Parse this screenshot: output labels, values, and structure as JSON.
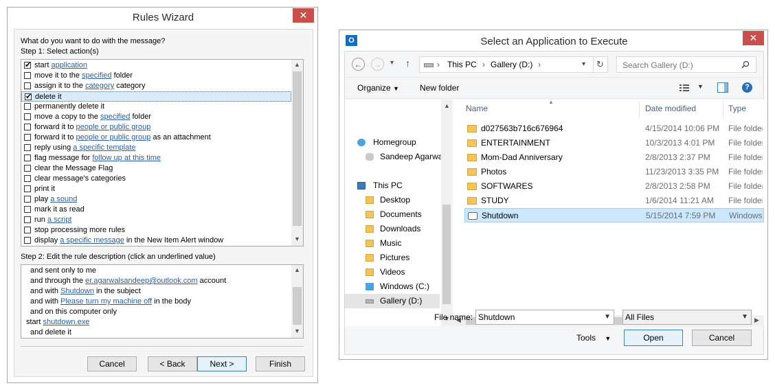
{
  "rules_wizard": {
    "title": "Rules Wizard",
    "close": "✕",
    "question": "What do you want to do with the message?",
    "step1": "Step 1: Select action(s)",
    "actions": [
      {
        "checked": true,
        "pre": "start ",
        "link": "application",
        "post": ""
      },
      {
        "checked": false,
        "pre": "move it to the ",
        "link": "specified",
        "post": " folder"
      },
      {
        "checked": false,
        "pre": "assign it to the ",
        "link": "category",
        "post": " category"
      },
      {
        "checked": true,
        "pre": "delete it",
        "link": "",
        "post": ""
      },
      {
        "checked": false,
        "pre": "permanently delete it",
        "link": "",
        "post": ""
      },
      {
        "checked": false,
        "pre": "move a copy to the ",
        "link": "specified",
        "post": " folder"
      },
      {
        "checked": false,
        "pre": "forward it to ",
        "link": "people or public group",
        "post": ""
      },
      {
        "checked": false,
        "pre": "forward it to ",
        "link": "people or public group",
        "post": " as an attachment"
      },
      {
        "checked": false,
        "pre": "reply using ",
        "link": "a specific template",
        "post": ""
      },
      {
        "checked": false,
        "pre": "flag message for ",
        "link": "follow up at this time",
        "post": ""
      },
      {
        "checked": false,
        "pre": "clear the Message Flag",
        "link": "",
        "post": ""
      },
      {
        "checked": false,
        "pre": "clear message's categories",
        "link": "",
        "post": ""
      },
      {
        "checked": false,
        "pre": "print it",
        "link": "",
        "post": ""
      },
      {
        "checked": false,
        "pre": "play ",
        "link": "a sound",
        "post": ""
      },
      {
        "checked": false,
        "pre": "mark it as read",
        "link": "",
        "post": ""
      },
      {
        "checked": false,
        "pre": "run ",
        "link": "a script",
        "post": ""
      },
      {
        "checked": false,
        "pre": "stop processing more rules",
        "link": "",
        "post": ""
      },
      {
        "checked": false,
        "pre": "display ",
        "link": "a specific message",
        "post": " in the New Item Alert window"
      }
    ],
    "check_mark": "✔",
    "step2": "Step 2: Edit the rule description (click an underlined value)",
    "description": [
      {
        "indent": 1,
        "pre": "and sent only to me",
        "link": "",
        "post": ""
      },
      {
        "indent": 1,
        "pre": "and through the ",
        "link": "er.agarwalsandeep@outlook.com",
        "post": " account"
      },
      {
        "indent": 1,
        "pre": "and with ",
        "link": "Shutdown",
        "post": " in the subject"
      },
      {
        "indent": 1,
        "pre": "and with ",
        "link": "Please turn my machine off",
        "post": " in the body"
      },
      {
        "indent": 1,
        "pre": "and on this computer only",
        "link": "",
        "post": ""
      },
      {
        "indent": 0,
        "pre": "start ",
        "link": "shutdown.exe",
        "post": ""
      },
      {
        "indent": 1,
        "pre": "and delete it",
        "link": "",
        "post": ""
      }
    ],
    "buttons": {
      "cancel": "Cancel",
      "back": "< Back",
      "next": "Next >",
      "finish": "Finish"
    }
  },
  "select_app": {
    "title": "Select an Application to Execute",
    "close": "✕",
    "app_icon_letter": "O",
    "nav": {
      "back": "←",
      "forward": "→",
      "dropdown": "▾",
      "up": "↑",
      "refresh": "↻"
    },
    "breadcrumb": [
      "This PC",
      "Gallery (D:)"
    ],
    "breadcrumb_sep": "›",
    "search_placeholder": "Search Gallery (D:)",
    "toolbar": {
      "organize": "Organize",
      "new_folder": "New folder",
      "help": "?"
    },
    "sidebar": [
      {
        "label": "Homegroup",
        "level": 0
      },
      {
        "label": "Sandeep Agarwa",
        "level": 1
      },
      {
        "label": "This PC",
        "level": 0
      },
      {
        "label": "Desktop",
        "level": 1
      },
      {
        "label": "Documents",
        "level": 1
      },
      {
        "label": "Downloads",
        "level": 1
      },
      {
        "label": "Music",
        "level": 1
      },
      {
        "label": "Pictures",
        "level": 1
      },
      {
        "label": "Videos",
        "level": 1
      },
      {
        "label": "Windows (C:)",
        "level": 1
      },
      {
        "label": "Gallery (D:)",
        "level": 1,
        "selected": true
      }
    ],
    "columns": {
      "name": "Name",
      "date": "Date modified",
      "type": "Type"
    },
    "files": [
      {
        "name": "d027563b716c676964",
        "date": "4/15/2014 10:06 PM",
        "type": "File folder",
        "kind": "folder"
      },
      {
        "name": "ENTERTAINMENT",
        "date": "10/3/2013 4:01 PM",
        "type": "File folder",
        "kind": "folder"
      },
      {
        "name": "Mom-Dad Anniversary",
        "date": "2/8/2013 2:37 PM",
        "type": "File folder",
        "kind": "folder"
      },
      {
        "name": "Photos",
        "date": "11/23/2013 3:35 PM",
        "type": "File folder",
        "kind": "folder"
      },
      {
        "name": "SOFTWARES",
        "date": "2/8/2013 2:58 PM",
        "type": "File folder",
        "kind": "folder"
      },
      {
        "name": "STUDY",
        "date": "1/6/2014 11:21 AM",
        "type": "File folder",
        "kind": "folder"
      },
      {
        "name": "Shutdown",
        "date": "5/15/2014 7:59 PM",
        "type": "Windows",
        "kind": "shortcut",
        "selected": true
      }
    ],
    "file_name_label": "File name:",
    "file_name_value": "Shutdown",
    "file_type_value": "All Files",
    "buttons": {
      "tools": "Tools",
      "open": "Open",
      "cancel": "Cancel"
    },
    "colors": {
      "accent": "#3c7fb1",
      "selection": "#cce8ff",
      "close": "#c7504c",
      "folder": "#f2c55c"
    }
  }
}
